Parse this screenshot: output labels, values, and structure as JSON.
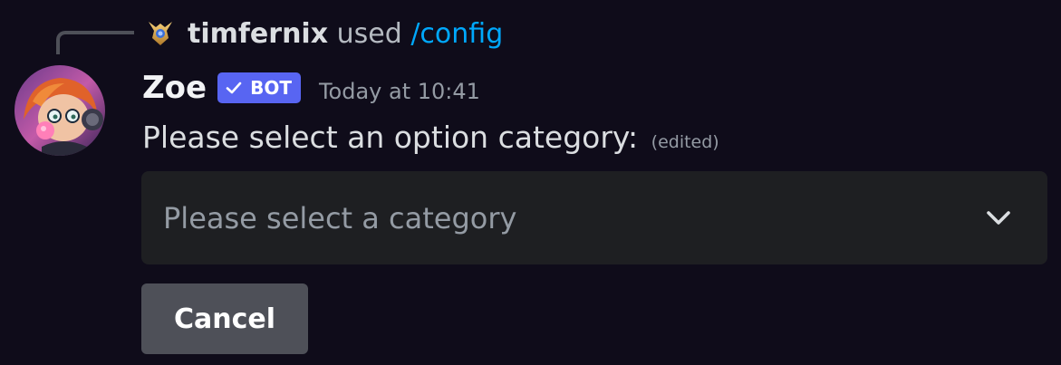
{
  "reply": {
    "username": "timfernix",
    "used_text": "used",
    "command": "/config",
    "avatar_icon": "reply-user-avatar"
  },
  "message": {
    "author": "Zoe",
    "bot_badge": "BOT",
    "timestamp": "Today at 10:41",
    "content": "Please select an option category:",
    "edited_label": "(edited)",
    "avatar_icon": "bot-avatar"
  },
  "select_menu": {
    "placeholder": "Please select a category"
  },
  "buttons": {
    "cancel_label": "Cancel"
  },
  "colors": {
    "background": "#0f0c1a",
    "badge": "#5865f2",
    "command_link": "#00a8fc",
    "select_bg": "#1e1f22",
    "cancel_bg": "#4e5058"
  }
}
